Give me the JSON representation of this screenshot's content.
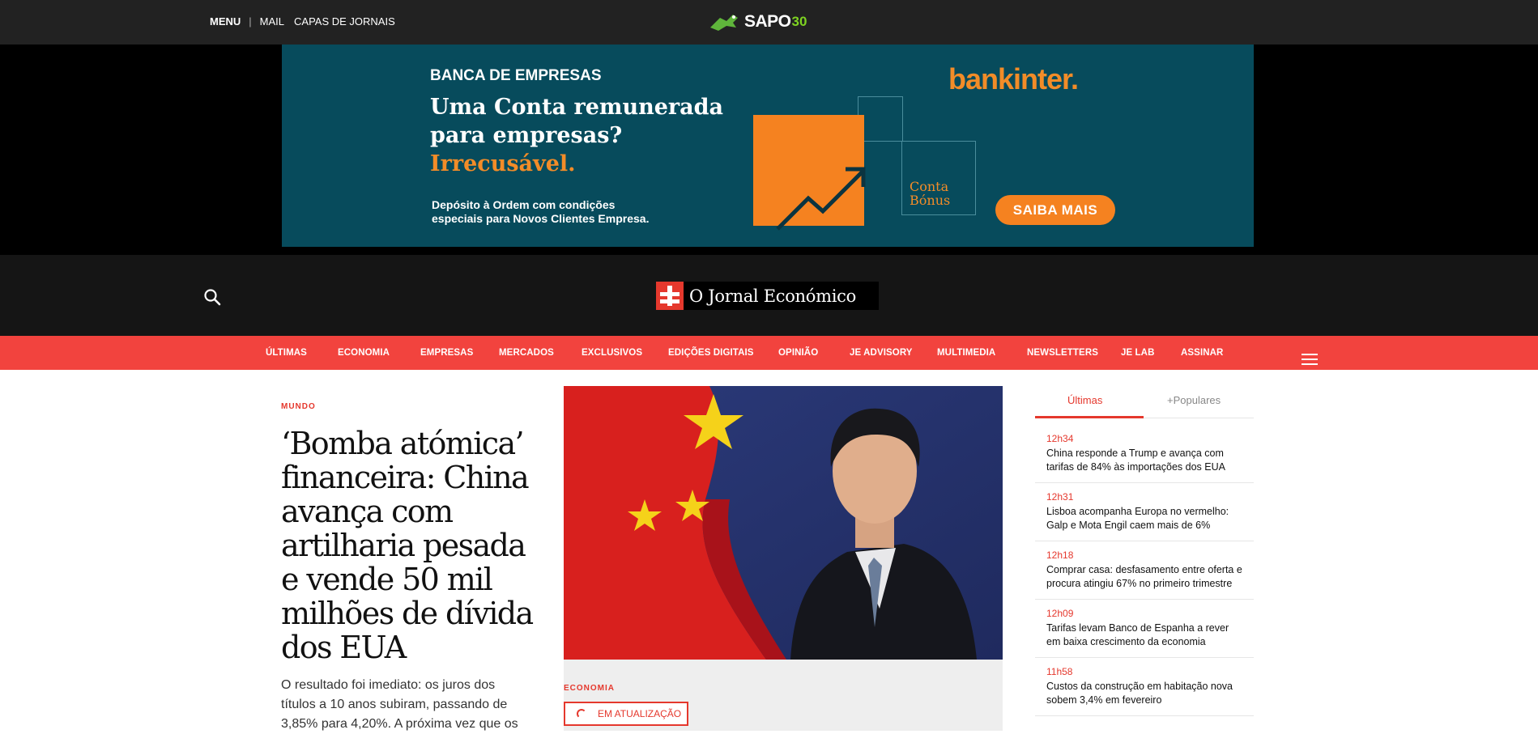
{
  "sapo_bar": {
    "menu_label": "MENU",
    "links": [
      "MAIL",
      "CAPAS DE JORNAIS"
    ],
    "logo_text": "SAPO",
    "logo_badge": "30"
  },
  "ad": {
    "kicker": "BANCA DE EMPRESAS",
    "headline_line1": "Uma Conta remunerada",
    "headline_line2": "para empresas?",
    "headline_highlight": "Irrecusável.",
    "subtext": "Depósito à Ordem com condições especiais para Novos Clientes Empresa.",
    "brand": "bankinter.",
    "product_line1": "Conta",
    "product_line2": "Bónus",
    "cta": "SAIBA MAIS",
    "colors": {
      "background": "#074b5c",
      "accent": "#f58220"
    }
  },
  "header": {
    "site_name": "O Jornal Económico",
    "search_icon": "search-icon"
  },
  "nav": {
    "items": [
      "ÚLTIMAS",
      "ECONOMIA",
      "EMPRESAS",
      "MERCADOS",
      "EXCLUSIVOS",
      "EDIÇÕES DIGITAIS",
      "OPINIÃO",
      "JE ADVISORY",
      "MULTIMEDIA",
      "NEWSLETTERS",
      "JE LAB",
      "ASSINAR"
    ],
    "menu_icon": "hamburger-icon",
    "color": "#f2433e"
  },
  "lead_story": {
    "category": "MUNDO",
    "headline": "‘Bomba atómica’ financeira: China avança com artilharia pesada e vende 50 mil milhões de dívida dos EUA",
    "excerpt": "O resultado foi imediato: os juros dos títulos a 10 anos subiram, passando de 3,85% para 4,20%. A próxima vez que os"
  },
  "featured": {
    "category": "ECONOMIA",
    "badge": "EM ATUALIZAÇÃO"
  },
  "sidebar": {
    "tabs": [
      "Últimas",
      "+Populares"
    ],
    "active_tab": "Últimas",
    "items": [
      {
        "time": "12h34",
        "title": "China responde a Trump e avança com tarifas de 84% às importações dos EUA"
      },
      {
        "time": "12h31",
        "title": "Lisboa acompanha Europa no vermelho: Galp e Mota Engil caem mais de 6%"
      },
      {
        "time": "12h18",
        "title": "Comprar casa: desfasamento entre oferta e procura atingiu 67% no primeiro trimestre"
      },
      {
        "time": "12h09",
        "title": "Tarifas levam Banco de Espanha a rever em baixa crescimento da economia"
      },
      {
        "time": "11h58",
        "title": "Custos da construção em habitação nova sobem 3,4% em fevereiro"
      }
    ]
  }
}
